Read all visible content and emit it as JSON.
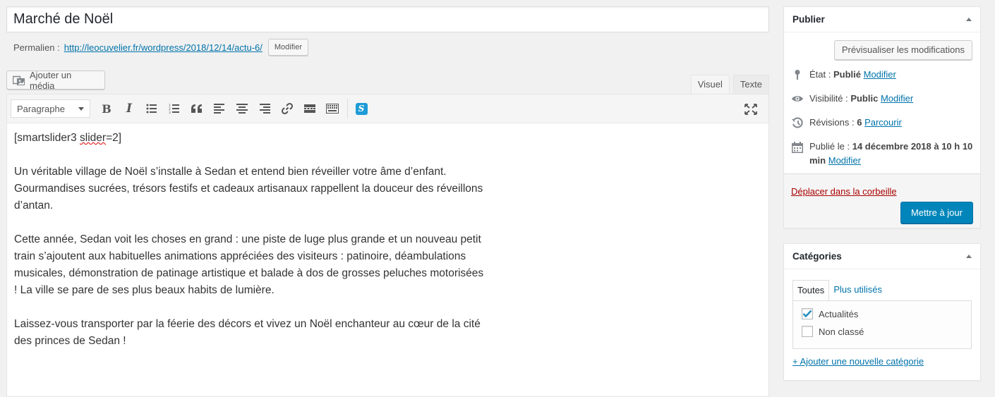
{
  "post": {
    "title": "Marché de Noël",
    "permalink_label": "Permalien :",
    "permalink_prefix": "http://leocuvelier.fr/wordpress/2018/12/14/",
    "permalink_slug": "actu-6",
    "permalink_suffix": "/",
    "modify_button": "Modifier"
  },
  "media_button": "Ajouter un média",
  "editor_tabs": {
    "visual": "Visuel",
    "text": "Texte"
  },
  "toolbar": {
    "format_select": "Paragraphe",
    "bold": "B",
    "italic": "I",
    "smartslider": "S"
  },
  "content": {
    "shortcode_prefix": "[smartslider3 ",
    "shortcode_misspelled": "slider",
    "shortcode_suffix": "=2]",
    "paragraphs": [
      "Un véritable village de Noël s’installe à Sedan et entend bien réveiller votre âme d’enfant. Gourmandises sucrées, trésors festifs et cadeaux artisanaux rappellent la douceur des réveillons d’antan.",
      "Cette année, Sedan voit les choses en grand : une piste de luge plus grande et un nouveau petit train s’ajoutent aux habituelles animations appréciées des visiteurs : patinoire, déambulations musicales, démonstration de patinage artistique et balade à dos de grosses peluches motorisées ! La ville se pare de ses plus beaux habits de lumière.",
      "Laissez-vous transporter par la féerie des décors et vivez un Noël enchanteur au cœur de la cité des princes de Sedan !"
    ]
  },
  "publish": {
    "heading": "Publier",
    "preview_button": "Prévisualiser les modifications",
    "status_label": "État :",
    "status_value": "Publié",
    "visibility_label": "Visibilité :",
    "visibility_value": "Public",
    "revisions_label": "Révisions :",
    "revisions_value": "6",
    "revisions_link": "Parcourir",
    "published_label": "Publié le :",
    "published_value": "14 décembre 2018 à 10 h 10 min",
    "edit_link": "Modifier",
    "trash_link": "Déplacer dans la corbeille",
    "update_button": "Mettre à jour"
  },
  "categories": {
    "heading": "Catégories",
    "tab_all": "Toutes",
    "tab_popular": "Plus utilisés",
    "items": [
      {
        "label": "Actualités",
        "checked": true
      },
      {
        "label": "Non classé",
        "checked": false
      }
    ],
    "add_link": "+ Ajouter une nouvelle catégorie"
  },
  "colors": {
    "accent": "#0073aa",
    "primary_button": "#0085ba",
    "trash": "#a00000",
    "smartslider": "#1e9bd7"
  }
}
